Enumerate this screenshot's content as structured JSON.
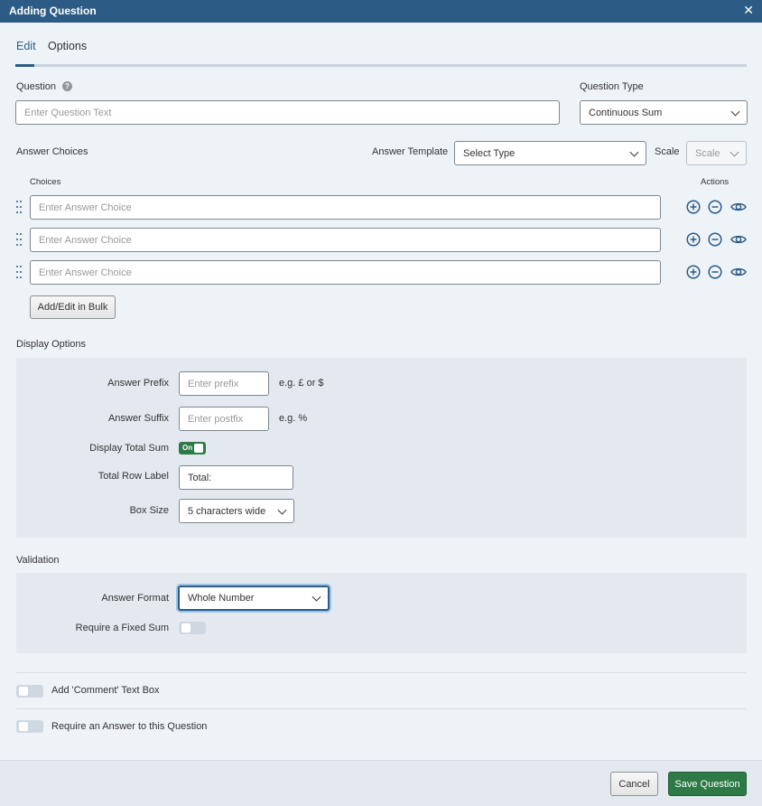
{
  "window": {
    "title": "Adding Question"
  },
  "tabs": [
    {
      "label": "Edit"
    },
    {
      "label": "Options"
    }
  ],
  "question": {
    "label": "Question",
    "placeholder": "Enter Question Text",
    "type_label": "Question Type",
    "type_value": "Continuous Sum"
  },
  "answers": {
    "section_label": "Answer Choices",
    "template_label": "Answer Template",
    "template_value": "Select Type",
    "scale_label": "Scale",
    "scale_value": "Scale",
    "choices_header": "Choices",
    "actions_header": "Actions",
    "choices": [
      {
        "placeholder": "Enter Answer Choice"
      },
      {
        "placeholder": "Enter Answer Choice"
      },
      {
        "placeholder": "Enter Answer Choice"
      }
    ],
    "bulk_button": "Add/Edit in Bulk"
  },
  "display_options": {
    "section_label": "Display Options",
    "prefix_label": "Answer Prefix",
    "prefix_placeholder": "Enter prefix",
    "prefix_hint": "e.g. £ or $",
    "suffix_label": "Answer Suffix",
    "suffix_placeholder": "Enter postfix",
    "suffix_hint": "e.g. %",
    "total_sum_label": "Display Total Sum",
    "total_sum_toggle": "On",
    "total_row_label": "Total Row Label",
    "total_row_value": "Total:",
    "box_size_label": "Box Size",
    "box_size_value": "5 characters wide"
  },
  "validation": {
    "section_label": "Validation",
    "format_label": "Answer Format",
    "format_value": "Whole Number",
    "fixed_sum_label": "Require a Fixed Sum"
  },
  "extras": {
    "comment_label": "Add 'Comment' Text Box",
    "require_label": "Require an Answer to this Question"
  },
  "footer": {
    "cancel": "Cancel",
    "save": "Save Question"
  },
  "colors": {
    "header": "#2c5c85",
    "primary": "#2d7a46",
    "panel": "#e3e9ef"
  }
}
